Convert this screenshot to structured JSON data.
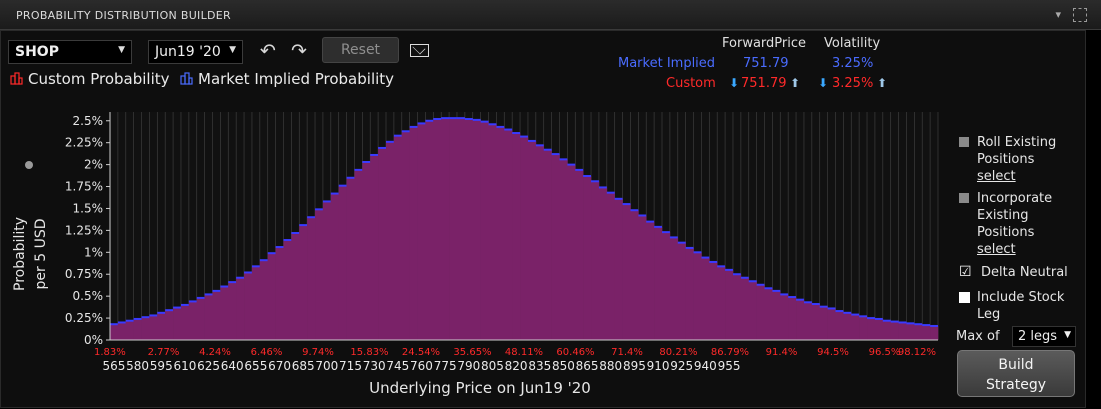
{
  "window": {
    "title": "PROBABILITY DISTRIBUTION BUILDER",
    "menu_caret": "▾"
  },
  "toolbar": {
    "symbol": "SHOP",
    "expiry": "Jun19 '20",
    "reset_label": "Reset",
    "undo_icon": "undo-icon",
    "redo_icon": "redo-icon",
    "mail_icon": "mail-icon"
  },
  "legend": {
    "custom": "Custom Probability",
    "market": "Market Implied Probability"
  },
  "summary": {
    "forward_header": "ForwardPrice",
    "vol_header": "Volatility",
    "market_label": "Market Implied",
    "market_forward": "751.79",
    "market_vol": "3.25%",
    "custom_label": "Custom",
    "custom_forward": "751.79",
    "custom_vol": "3.25%"
  },
  "sidebar": {
    "roll_label_1": "Roll Existing",
    "roll_label_2": "Positions",
    "roll_link": "select",
    "incorp_label_1": "Incorporate",
    "incorp_label_2": "Existing",
    "incorp_label_3": "Positions",
    "incorp_link": "select",
    "delta_neutral": "Delta Neutral",
    "include_stock_1": "Include Stock",
    "include_stock_2": "Leg",
    "max_of": "Max of",
    "legs": "2 legs",
    "build_1": "Build",
    "build_2": "Strategy"
  },
  "colors": {
    "bar_fill": "#7a2268",
    "bar_top": "#3a3aff",
    "custom": "#ff2a2a",
    "market": "#4a6cff"
  },
  "chart_data": {
    "type": "bar",
    "xlabel": "Underlying Price on Jun19 '20",
    "ylabel": [
      "Probability",
      "per 5 USD"
    ],
    "ylim": [
      0,
      2.6
    ],
    "yticks": [
      "0%",
      "0.25%",
      "0.5%",
      "0.75%",
      "1%",
      "1.25%",
      "1.5%",
      "1.75%",
      "2%",
      "2.25%",
      "2.5%"
    ],
    "xtick_labels": [
      "565",
      "580",
      "595",
      "610",
      "625",
      "640",
      "655",
      "670",
      "685",
      "700",
      "715",
      "730",
      "745",
      "760",
      "775",
      "790",
      "805",
      "820",
      "835",
      "850",
      "865",
      "880",
      "895",
      "910",
      "925",
      "940",
      "955"
    ],
    "cumulative_labels": [
      "1.83%",
      "2.77%",
      "4.24%",
      "6.46%",
      "9.74%",
      "15.83%",
      "24.54%",
      "35.65%",
      "48.11%",
      "60.46%",
      "71.4%",
      "80.21%",
      "86.79%",
      "91.4%",
      "94.5%",
      "96.5%",
      "98.12%"
    ],
    "x_start": 565,
    "x_step": 5,
    "values": [
      0.18,
      0.2,
      0.22,
      0.24,
      0.26,
      0.28,
      0.31,
      0.34,
      0.37,
      0.4,
      0.44,
      0.48,
      0.52,
      0.56,
      0.61,
      0.66,
      0.71,
      0.77,
      0.84,
      0.91,
      0.99,
      1.06,
      1.14,
      1.22,
      1.31,
      1.4,
      1.49,
      1.58,
      1.67,
      1.76,
      1.85,
      1.94,
      2.03,
      2.11,
      2.19,
      2.26,
      2.33,
      2.38,
      2.43,
      2.47,
      2.5,
      2.52,
      2.53,
      2.53,
      2.53,
      2.52,
      2.51,
      2.49,
      2.46,
      2.43,
      2.4,
      2.36,
      2.32,
      2.27,
      2.22,
      2.17,
      2.12,
      2.06,
      2.0,
      1.94,
      1.87,
      1.81,
      1.74,
      1.68,
      1.61,
      1.55,
      1.48,
      1.42,
      1.35,
      1.29,
      1.23,
      1.17,
      1.11,
      1.05,
      1.0,
      0.94,
      0.89,
      0.84,
      0.8,
      0.75,
      0.71,
      0.67,
      0.63,
      0.59,
      0.56,
      0.52,
      0.49,
      0.46,
      0.43,
      0.41,
      0.38,
      0.36,
      0.33,
      0.31,
      0.29,
      0.27,
      0.25,
      0.24,
      0.22,
      0.21,
      0.2,
      0.19,
      0.18,
      0.17,
      0.16
    ]
  }
}
